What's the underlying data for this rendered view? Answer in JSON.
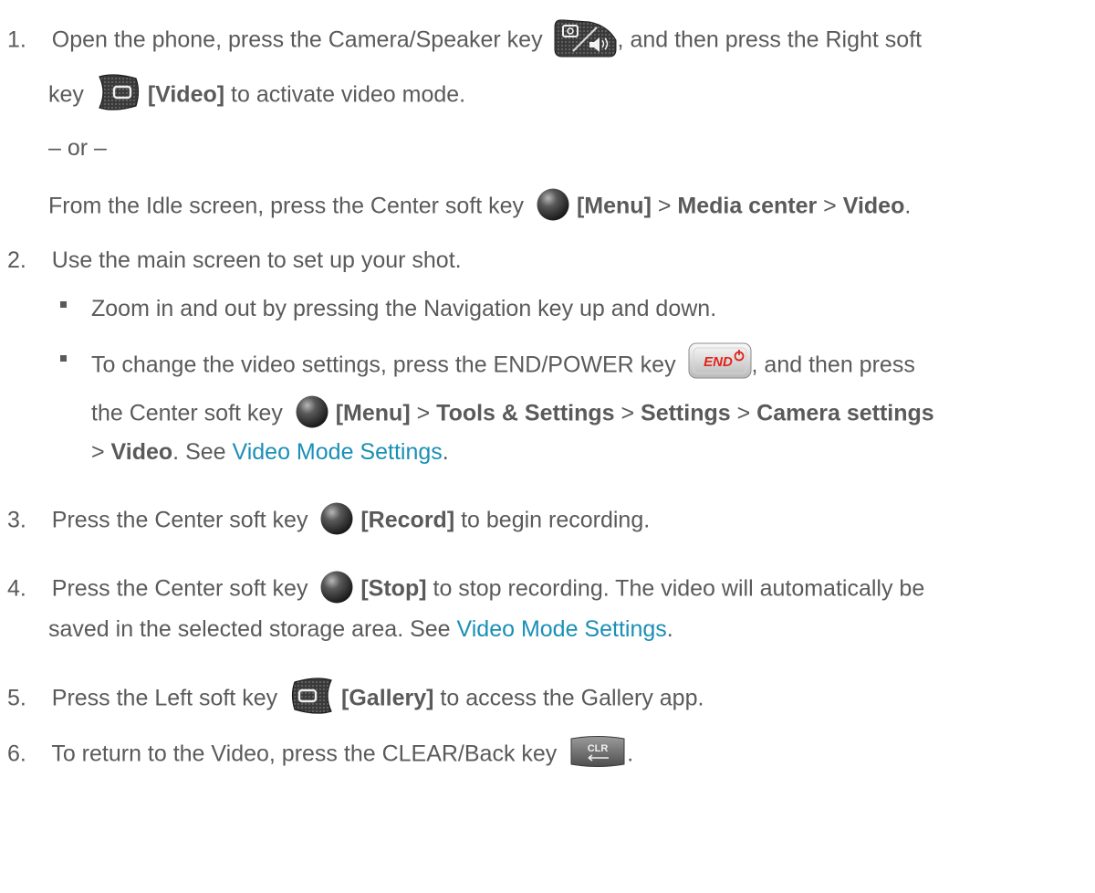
{
  "steps": [
    {
      "number": "1.",
      "l1": {
        "a": "Open the phone, press the Camera/Speaker key",
        "b": ", and then press the Right soft"
      },
      "l2": {
        "a": "key",
        "b": "[Video]",
        "c": " to activate video mode."
      },
      "or": "– or –",
      "l3": {
        "a": "From the Idle screen, press the Center soft key",
        "b": "[Menu]",
        "c": " > ",
        "d": "Media center",
        "e": " > ",
        "f": "Video",
        "g": "."
      }
    },
    {
      "number": "2.",
      "text": "Use the main screen to set up your shot.",
      "bullets": [
        {
          "text": "Zoom in and out by pressing the Navigation key up and down."
        },
        {
          "l1": {
            "a": "To change the video settings, press the END/POWER key",
            "b": ", and then press"
          },
          "l2": {
            "a": "the Center soft key",
            "b": "[Menu]",
            "c": " > ",
            "d": "Tools & Settings",
            "e": " > ",
            "f": "Settings",
            "g": " > ",
            "h": "Camera settings"
          },
          "l3": {
            "a": "> ",
            "b": "Video",
            "c": ". See ",
            "d": "Video Mode Settings",
            "e": "."
          }
        }
      ]
    },
    {
      "number": "3.",
      "l1": {
        "a": "Press the Center soft key",
        "b": "[Record]",
        "c": " to begin recording."
      }
    },
    {
      "number": "4.",
      "l1": {
        "a": "Press the Center soft key",
        "b": "[Stop]",
        "c": " to stop recording. The video will automatically be"
      },
      "l2": {
        "a": "saved in the selected storage area. See ",
        "b": "Video Mode Settings",
        "c": "."
      }
    },
    {
      "number": "5.",
      "l1": {
        "a": "Press the Left soft key",
        "b": "[Gallery]",
        "c": " to access the Gallery app."
      }
    },
    {
      "number": "6.",
      "l1": {
        "a": "To return to the Video, press the CLEAR/Back key",
        "b": "."
      }
    }
  ],
  "keys": {
    "end_label": "END",
    "clr_label": "CLR"
  }
}
